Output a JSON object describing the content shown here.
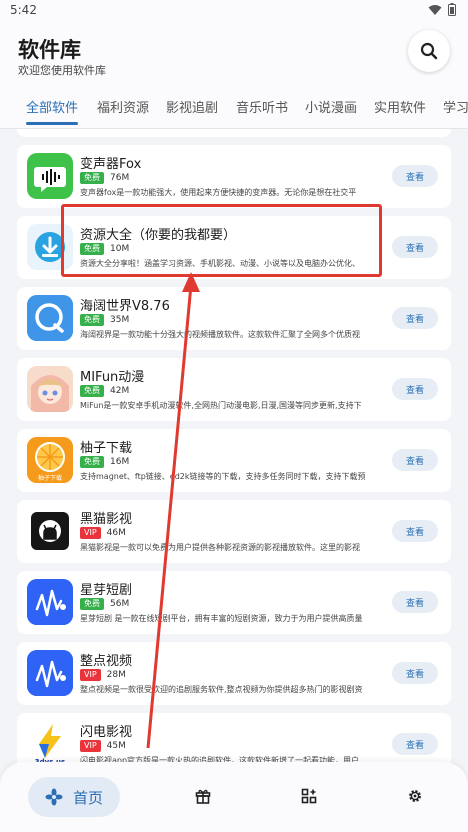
{
  "status_bar": {
    "time": "5:42"
  },
  "header": {
    "title": "软件库",
    "subtitle": "欢迎您使用软件库"
  },
  "tabs": [
    {
      "label": "全部软件",
      "active": true
    },
    {
      "label": "福利资源"
    },
    {
      "label": "影视追剧"
    },
    {
      "label": "音乐听书"
    },
    {
      "label": "小说漫画"
    },
    {
      "label": "实用软件"
    },
    {
      "label": "学习"
    }
  ],
  "apps": [
    {
      "name": "变声器Fox",
      "badge": "免费",
      "size": "76M",
      "desc": "变声器fox是一款功能强大，使用起来方便快捷的变声器。无论你是想在社交平",
      "button": "查看"
    },
    {
      "name": "资源大全（你要的我都要）",
      "badge": "免费",
      "size": "10M",
      "desc": "资源大全分享啦！涵盖学习资源、手机影视、动漫、小说等以及电脑办公优化、",
      "button": "查看"
    },
    {
      "name": "海阔世界V8.76",
      "badge": "免费",
      "size": "35M",
      "desc": "海阔视界是一款功能十分强大的视频播放软件。这款软件汇聚了全网多个优质视",
      "button": "查看"
    },
    {
      "name": "MIFun动漫",
      "badge": "免费",
      "size": "42M",
      "desc": "MiFun是一款安卓手机动漫软件,全网热门动漫电影,日漫,国漫等同步更新,支持下",
      "button": "查看"
    },
    {
      "name": "柚子下载",
      "badge": "免费",
      "size": "16M",
      "desc": "支持magnet、ftp链接、ed2k链接等的下载，支持多任务同时下载，支持下载预",
      "button": "查看"
    },
    {
      "name": "黑猫影视",
      "badge": "VIP",
      "size": "46M",
      "desc": "黑猫影视是一款可以免费为用户提供各种影视资源的影视播放软件。这里的影视",
      "button": "查看"
    },
    {
      "name": "星芽短剧",
      "badge": "免费",
      "size": "56M",
      "desc": "星芽短剧 是一款在线短剧平台，拥有丰富的短剧资源，致力于为用户提供高质量",
      "button": "查看"
    },
    {
      "name": "整点视频",
      "badge": "VIP",
      "size": "28M",
      "desc": "整点视频是一款很受欢迎的追剧服务软件,整点视频为你提供超多热门的影视剧资",
      "button": "查看"
    },
    {
      "name": "闪电影视",
      "badge": "VIP",
      "size": "45M",
      "desc": "闪电影视app官方版是一款火热的追剧软件，这款软件新增了一起看功能，用户",
      "button": "查看"
    }
  ],
  "icons": {
    "voice_changer": "sound-wave-bubble",
    "resource_download": "cloud-download",
    "browser": "search-bubble",
    "anime": "anime-character",
    "yuzi": "orange-slice",
    "heimao": "github-cat",
    "music_note": "waveform-note",
    "shandian": "lightning"
  },
  "icon_caption": {
    "yuzi": "柚子下载",
    "shandian": "3dys.us"
  },
  "bottom_nav": {
    "home_label": "首页",
    "items": [
      "home-icon",
      "gift-box-icon",
      "grid-plus-icon",
      "gear-icon"
    ]
  },
  "colors": {
    "accent": "#2a6fb5",
    "free": "#35b04a",
    "vip": "#e8343a",
    "annotation": "#e0392f"
  }
}
